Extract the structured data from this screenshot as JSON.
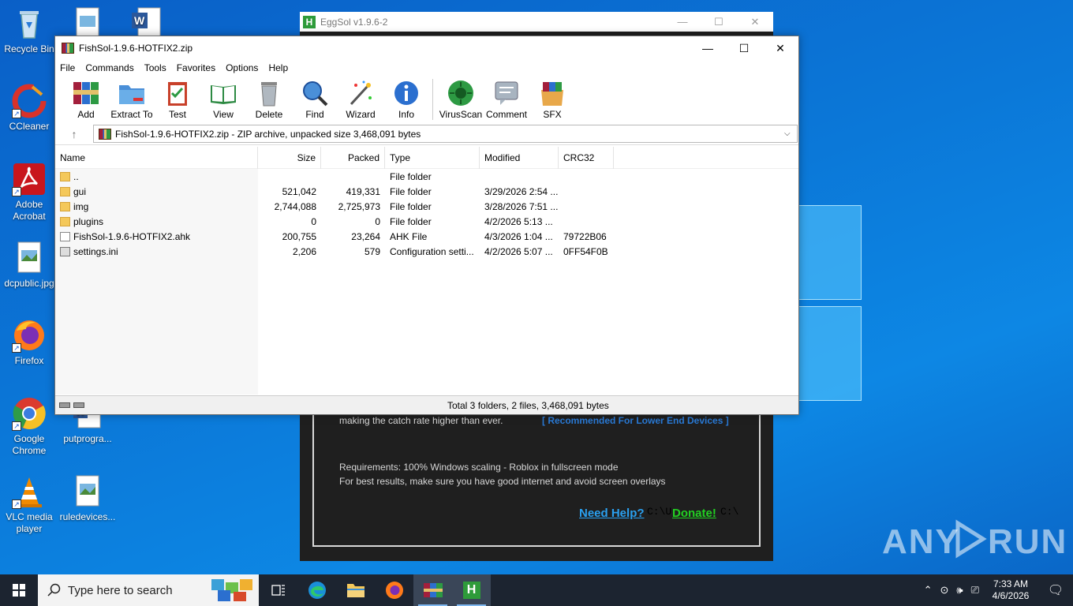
{
  "desktop": {
    "icons": [
      {
        "label": "Recycle Bin"
      },
      {
        "label": "CCleaner"
      },
      {
        "label": "Adobe Acrobat"
      },
      {
        "label": "dcpublic.jpg"
      },
      {
        "label": "Firefox"
      },
      {
        "label": "Google Chrome"
      },
      {
        "label": "VLC media player"
      },
      {
        "label": "putprogra..."
      },
      {
        "label": "ruledevices..."
      }
    ],
    "watermark": "ANY RUN"
  },
  "eggsol": {
    "title": "EggSol v1.9.6-2",
    "catch_text": "making the catch rate higher than ever.",
    "recommended": "[ Recommended For Lower End Devices ]",
    "requirements": "Requirements: 100% Windows scaling - Roblox in fullscreen mode",
    "best_results": "For best results, make sure you have good internet and avoid screen overlays",
    "help_link": "Need Help?",
    "path1": "C:\\U",
    "donate_link": "Donate!",
    "path2": "C:\\"
  },
  "winrar": {
    "title": "FishSol-1.9.6-HOTFIX2.zip",
    "menu": [
      "File",
      "Commands",
      "Tools",
      "Favorites",
      "Options",
      "Help"
    ],
    "toolbar": [
      "Add",
      "Extract To",
      "Test",
      "View",
      "Delete",
      "Find",
      "Wizard",
      "Info",
      "VirusScan",
      "Comment",
      "SFX"
    ],
    "address": "FishSol-1.9.6-HOTFIX2.zip - ZIP archive, unpacked size 3,468,091 bytes",
    "columns": {
      "name": "Name",
      "size": "Size",
      "packed": "Packed",
      "type": "Type",
      "modified": "Modified",
      "crc": "CRC32"
    },
    "rows": [
      {
        "name": "..",
        "size": "",
        "packed": "",
        "type": "File folder",
        "modified": "",
        "crc": "",
        "kind": "folder"
      },
      {
        "name": "gui",
        "size": "521,042",
        "packed": "419,331",
        "type": "File folder",
        "modified": "3/29/2026 2:54 ...",
        "crc": "",
        "kind": "folder"
      },
      {
        "name": "img",
        "size": "2,744,088",
        "packed": "2,725,973",
        "type": "File folder",
        "modified": "3/28/2026 7:51 ...",
        "crc": "",
        "kind": "folder"
      },
      {
        "name": "plugins",
        "size": "0",
        "packed": "0",
        "type": "File folder",
        "modified": "4/2/2026 5:13 ...",
        "crc": "",
        "kind": "folder"
      },
      {
        "name": "FishSol-1.9.6-HOTFIX2.ahk",
        "size": "200,755",
        "packed": "23,264",
        "type": "AHK File",
        "modified": "4/3/2026 1:04 ...",
        "crc": "79722B06",
        "kind": "file"
      },
      {
        "name": "settings.ini",
        "size": "2,206",
        "packed": "579",
        "type": "Configuration setti...",
        "modified": "4/2/2026 5:07 ...",
        "crc": "0FF54F0B",
        "kind": "cfg"
      }
    ],
    "status": "Total 3 folders, 2 files, 3,468,091 bytes"
  },
  "taskbar": {
    "search_placeholder": "Type here to search",
    "time": "7:33 AM",
    "date": "4/6/2026"
  }
}
